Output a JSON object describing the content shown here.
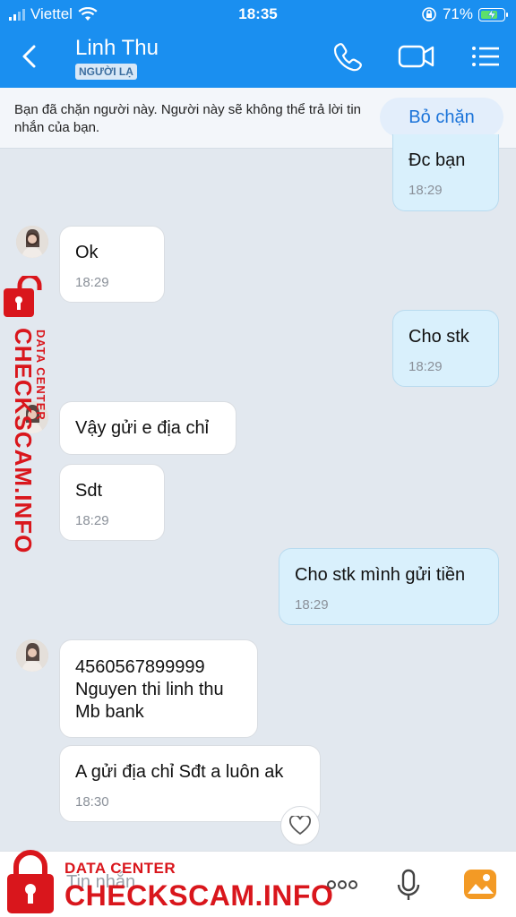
{
  "status": {
    "carrier": "Viettel",
    "time": "18:35",
    "battery": "71%"
  },
  "header": {
    "contact_name": "Linh Thu",
    "badge": "NGƯỜI LẠ",
    "icons": [
      "back-icon",
      "phone-icon",
      "video-call-icon",
      "menu-icon"
    ]
  },
  "banner": {
    "text": "Bạn đã chặn người này. Người này sẽ không thể trả lời tin nhắn của bạn.",
    "button": "Bỏ chặn"
  },
  "messages": [
    {
      "direction": "out",
      "text": "Đc bạn",
      "time": "18:29"
    },
    {
      "direction": "in",
      "text": "Ok",
      "time": "18:29"
    },
    {
      "direction": "out",
      "text": "Cho stk",
      "time": "18:29"
    },
    {
      "direction": "in",
      "text": "Vậy gửi e địa chỉ",
      "time": ""
    },
    {
      "direction": "in",
      "text": "Sdt",
      "time": "18:29"
    },
    {
      "direction": "out",
      "text": "Cho stk mình gửi tiền",
      "time": "18:29"
    },
    {
      "direction": "in",
      "text": "4560567899999\nNguyen thi linh thu\nMb bank",
      "time": ""
    },
    {
      "direction": "in",
      "text": "A gửi địa chỉ Sđt a luôn ak",
      "time": "18:30"
    }
  ],
  "composer": {
    "placeholder": "Tin nhắn",
    "icons": [
      "more-icon",
      "microphone-icon",
      "image-icon"
    ]
  },
  "watermark": {
    "main": "CHECKSCAM.INFO",
    "sub": "DATA CENTER"
  },
  "colors": {
    "header": "#1a8ff0",
    "outgoing_bubble": "#d9f0fc",
    "incoming_bubble": "#ffffff",
    "watermark": "#d9161c"
  }
}
